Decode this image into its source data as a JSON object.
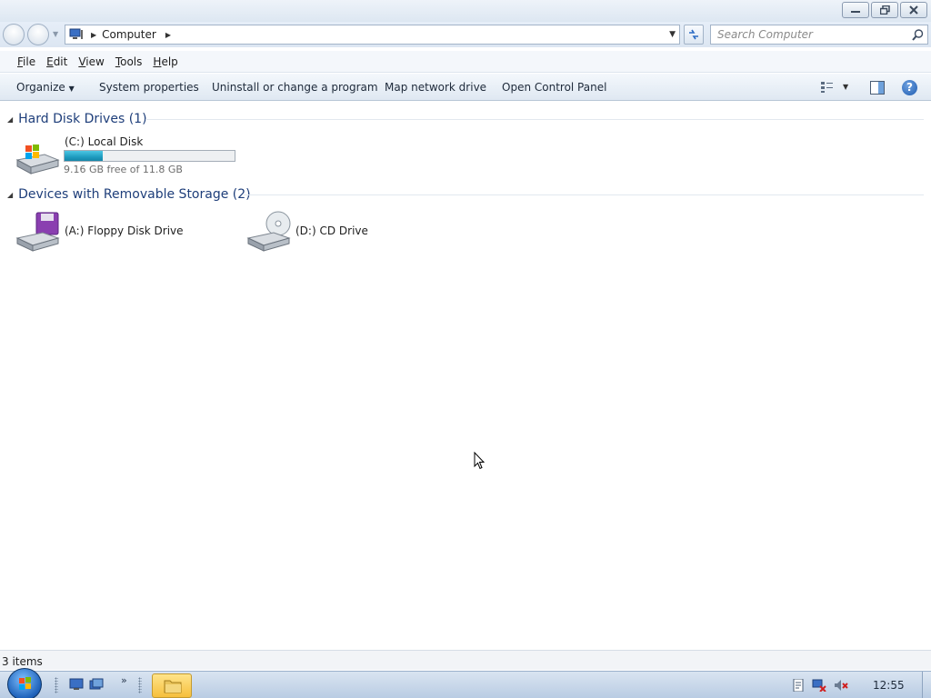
{
  "window": {
    "caption_buttons": [
      "minimize-icon",
      "restore-icon",
      "close-icon"
    ]
  },
  "address": {
    "location": "Computer",
    "search_placeholder": "Search Computer"
  },
  "menu": {
    "items": [
      {
        "label": "File",
        "accel": "F",
        "rest": "ile"
      },
      {
        "label": "Edit",
        "accel": "E",
        "rest": "dit"
      },
      {
        "label": "View",
        "accel": "V",
        "rest": "iew"
      },
      {
        "label": "Tools",
        "accel": "T",
        "rest": "ools"
      },
      {
        "label": "Help",
        "accel": "H",
        "rest": "elp"
      }
    ]
  },
  "commands": {
    "organize": "Organize",
    "system_properties": "System properties",
    "uninstall": "Uninstall or change a program",
    "map_drive": "Map network drive",
    "control_panel": "Open Control Panel"
  },
  "groups": {
    "hard_disks": {
      "title": "Hard Disk Drives (1)",
      "drives": [
        {
          "name": "(C:) Local Disk",
          "free_text": "9.16 GB free of 11.8 GB",
          "used_fraction": 0.224,
          "icon": "windows-hard-disk-icon"
        }
      ]
    },
    "removable": {
      "title": "Devices with Removable Storage (2)",
      "drives": [
        {
          "name": "(A:) Floppy Disk Drive",
          "icon": "floppy-drive-icon"
        },
        {
          "name": "(D:) CD Drive",
          "icon": "cd-drive-icon"
        }
      ]
    }
  },
  "status": {
    "items_text": "3 items"
  },
  "taskbar": {
    "clock": "12:55"
  },
  "colors": {
    "accent_blue": "#1e3e7a",
    "bar_fill": "#1f9cc0"
  }
}
